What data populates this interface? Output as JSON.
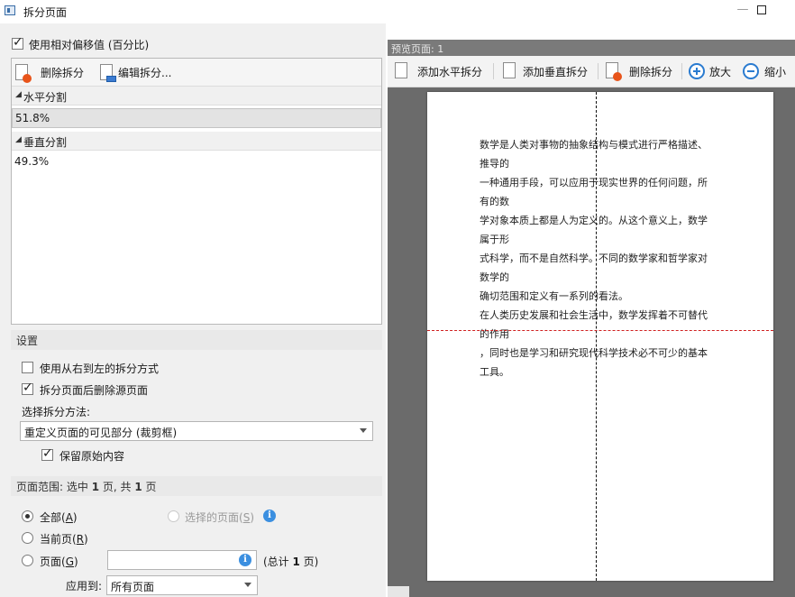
{
  "window": {
    "title": "拆分页面",
    "minimize": "—"
  },
  "left": {
    "use_relative_offset": {
      "label": "使用相对偏移值 (百分比)",
      "checked": true
    },
    "toolbar": {
      "delete_split": "删除拆分",
      "edit_split": "编辑拆分..."
    },
    "groups": [
      {
        "title": "水平分割",
        "values": [
          "51.8%"
        ]
      },
      {
        "title": "垂直分割",
        "values": [
          "49.3%"
        ]
      }
    ],
    "settings": {
      "title": "设置",
      "right_to_left": {
        "label": "使用从右到左的拆分方式",
        "checked": false
      },
      "delete_source": {
        "label": "拆分页面后删除源页面",
        "checked": true
      },
      "method_label": "选择拆分方法:",
      "method_value": "重定义页面的可见部分 (裁剪框)",
      "keep_original": {
        "label": "保留原始内容",
        "checked": true
      }
    },
    "range": {
      "title_prefix": "页面范围: 选中 ",
      "selected_count": "1",
      "title_mid": " 页, 共 ",
      "total_count": "1",
      "title_suffix": " 页",
      "all": {
        "label": "全部",
        "key": "A",
        "checked": true
      },
      "selected_pages": {
        "label": "选择的页面",
        "key": "S",
        "enabled": false
      },
      "current": {
        "label": "当前页",
        "key": "R"
      },
      "pages": {
        "label": "页面",
        "key": "G",
        "value": ""
      },
      "total_prefix": "(总计 ",
      "total_pages": "1",
      "total_suffix": " 页)",
      "apply_label": "应用到:",
      "apply_value": "所有页面"
    }
  },
  "preview": {
    "caption": "预览页面: 1",
    "toolbar": {
      "add_horizontal": "添加水平拆分",
      "add_vertical": "添加垂直拆分",
      "delete_split": "删除拆分",
      "zoom_in": "放大",
      "zoom_out": "缩小"
    },
    "page_text": [
      "数学是人类对事物的抽象结构与模式进行严格描述、",
      "推导的",
      "一种通用手段，可以应用于现实世界的任何问题，所",
      "有的数",
      "学对象本质上都是人为定义的。从这个意义上，数学",
      "属于形",
      "式科学，而不是自然科学。不同的数学家和哲学家对",
      "数学的",
      "确切范围和定义有一系列的看法。",
      "在人类历史发展和社会生活中，数学发挥着不可替代",
      "的作用",
      "，同时也是学习和研究现代科学技术必不可少的基本",
      "工具。"
    ],
    "colors": {
      "vertical_split": "#111111",
      "horizontal_split": "#d02020",
      "accent": "#2a7bd0"
    }
  }
}
